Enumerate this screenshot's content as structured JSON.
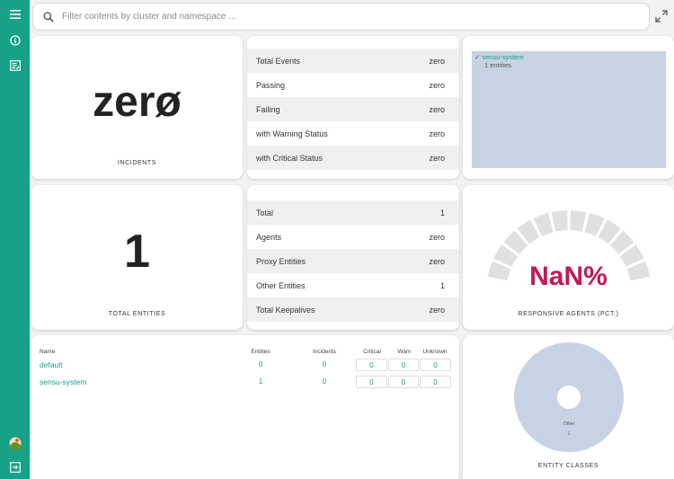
{
  "sidebar": {
    "icons": [
      "menu-icon",
      "info-icon",
      "checklist-icon",
      "avatar",
      "logout-icon"
    ]
  },
  "search": {
    "placeholder": "Filter contents by cluster and namespace ..."
  },
  "incidents": {
    "value": "zerø",
    "caption": "INCIDENTS"
  },
  "events": {
    "rows": [
      {
        "label": "Total Events",
        "value": "zero"
      },
      {
        "label": "Passing",
        "value": "zero"
      },
      {
        "label": "Failing",
        "value": "zero"
      },
      {
        "label": "with Warning Status",
        "value": "zero"
      },
      {
        "label": "with Critical Status",
        "value": "zero"
      }
    ]
  },
  "namespace_map": {
    "name": "sensu-system",
    "count": "1 entities",
    "color": "#c7d3e3"
  },
  "total_entities": {
    "value": "1",
    "caption": "TOTAL ENTITIES"
  },
  "entities": {
    "rows": [
      {
        "label": "Total",
        "value": "1"
      },
      {
        "label": "Agents",
        "value": "zero"
      },
      {
        "label": "Proxy Entities",
        "value": "zero"
      },
      {
        "label": "Other Entities",
        "value": "1"
      },
      {
        "label": "Total Keepalives",
        "value": "zero"
      }
    ]
  },
  "responsive": {
    "value": "NaN%",
    "caption": "RESPONSIVE AGENTS (PCT.)",
    "value_color": "#c2185b"
  },
  "namespaces": {
    "headers": [
      "Name",
      "Entities",
      "Incidents",
      "Critical",
      "Warn",
      "Unknown"
    ],
    "rows": [
      {
        "name": "default",
        "entities": "0",
        "incidents": "0",
        "critical": "0",
        "warn": "0",
        "unknown": "0"
      },
      {
        "name": "sensu-system",
        "entities": "1",
        "incidents": "0",
        "critical": "0",
        "warn": "0",
        "unknown": "0"
      }
    ]
  },
  "entity_classes": {
    "caption": "ENTITY CLASSES",
    "slice_label": "Other",
    "slice_value": "1",
    "color": "#c7d3e3"
  }
}
